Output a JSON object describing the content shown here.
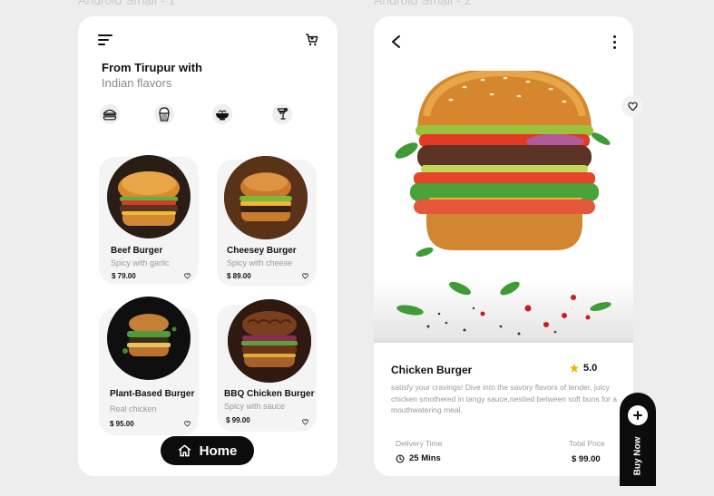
{
  "frames": {
    "screen1_label": "Android Small - 1",
    "screen2_label": "Android Small - 2"
  },
  "screen1": {
    "heading": "From  Tirupur with",
    "subheading": "Indian flavors",
    "categories": [
      {
        "name": "burger",
        "icon": "burger-icon"
      },
      {
        "name": "cupcake",
        "icon": "cupcake-icon"
      },
      {
        "name": "noodle bowl",
        "icon": "noodle-bowl-icon"
      },
      {
        "name": "drink",
        "icon": "drink-icon"
      }
    ],
    "products": [
      {
        "name": "Beef Burger",
        "description": "Spicy with garlic",
        "price": "$ 79.00"
      },
      {
        "name": "Cheesey Burger",
        "description": "Spicy with cheese",
        "price": "$ 89.00"
      },
      {
        "name": "Plant-Based Burger",
        "description": "Real chicken",
        "price": "$ 95.00"
      },
      {
        "name": "BBQ Chicken Burger",
        "description": "Spicy with sauce",
        "price": "$ 99.00"
      }
    ],
    "home_button": "Home"
  },
  "screen2": {
    "title": "Chicken Burger",
    "rating": "5.0",
    "description": "satisfy your cravings! Dive into the savory flavors of tender, juicy chicken smothered in tangy sauce,nestled between soft buns for a mouthwatering meal.",
    "delivery_label": "Delivery Time",
    "delivery_value": "25 Mins",
    "total_label": "Total Price",
    "total_value": "$ 99.00",
    "buy_button": "Buy Now"
  },
  "colors": {
    "background": "#ededed",
    "card": "#f4f4f4",
    "button": "#0c0c0c",
    "star": "#f5b301"
  }
}
